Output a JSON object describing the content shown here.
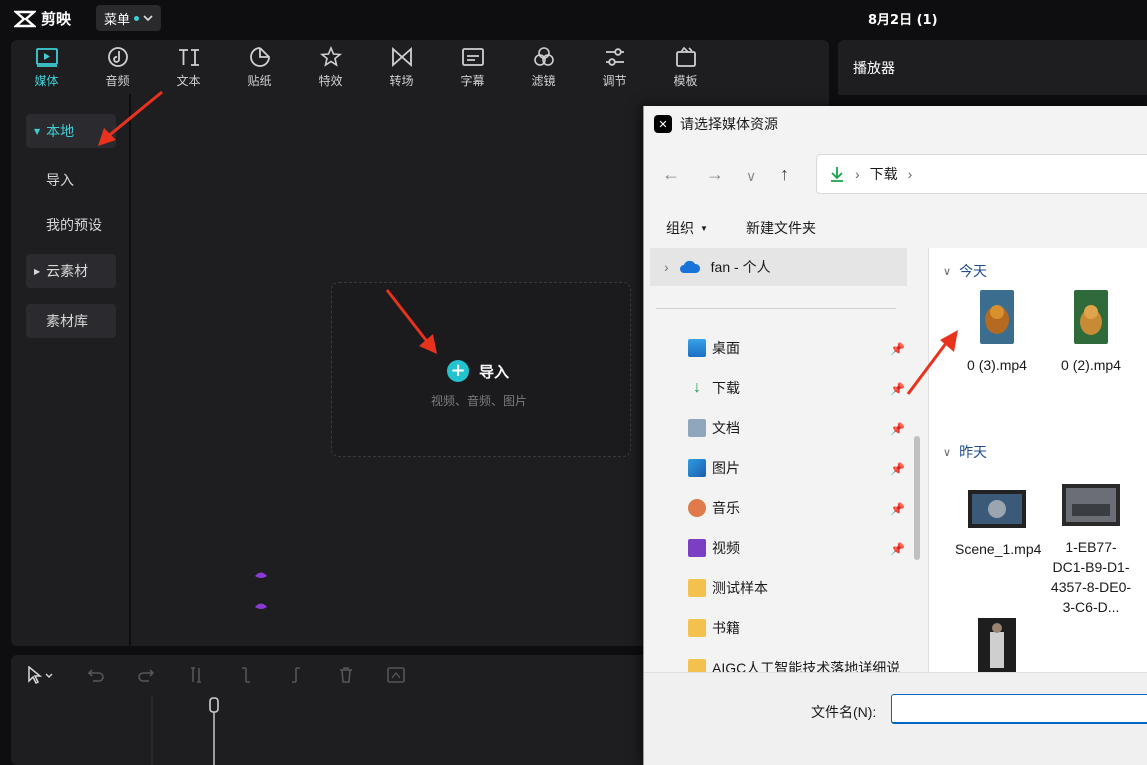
{
  "app": {
    "name": "剪映",
    "menu_label": "菜单",
    "project_title": "8月2日 (1)"
  },
  "tabs": [
    {
      "label": "媒体",
      "icon": "media-icon"
    },
    {
      "label": "音频",
      "icon": "audio-icon"
    },
    {
      "label": "文本",
      "icon": "text-icon"
    },
    {
      "label": "贴纸",
      "icon": "sticker-icon"
    },
    {
      "label": "特效",
      "icon": "effects-icon"
    },
    {
      "label": "转场",
      "icon": "transition-icon"
    },
    {
      "label": "字幕",
      "icon": "subtitle-icon"
    },
    {
      "label": "滤镜",
      "icon": "filter-icon"
    },
    {
      "label": "调节",
      "icon": "adjust-icon"
    },
    {
      "label": "模板",
      "icon": "template-icon"
    }
  ],
  "sidebar": {
    "local": "本地",
    "import": "导入",
    "presets": "我的预设",
    "cloud": "云素材",
    "library": "素材库"
  },
  "dropzone": {
    "import_label": "导入",
    "hint": "视频、音频、图片"
  },
  "player": {
    "title": "播放器"
  },
  "dialog": {
    "title": "请选择媒体资源",
    "breadcrumb": "下载",
    "organize": "组织",
    "new_folder": "新建文件夹",
    "onedrive": "fan - 个人",
    "nav_items": [
      {
        "label": "桌面",
        "pinned": true
      },
      {
        "label": "下载",
        "pinned": true
      },
      {
        "label": "文档",
        "pinned": true
      },
      {
        "label": "图片",
        "pinned": true
      },
      {
        "label": "音乐",
        "pinned": true
      },
      {
        "label": "视频",
        "pinned": true
      },
      {
        "label": "测试样本",
        "pinned": false
      },
      {
        "label": "书籍",
        "pinned": false
      },
      {
        "label": "AIGC人工智能技术落地详细说",
        "pinned": false
      }
    ],
    "group_today": "今天",
    "group_yesterday": "昨天",
    "files_today": [
      "0 (3).mp4",
      "0 (2).mp4"
    ],
    "files_yesterday": [
      "Scene_1.mp4",
      "1-EB77-DC1-B9-D1-4357-8-DE0-3-C6-D..."
    ],
    "filename_label": "文件名(N):",
    "filename_value": ""
  },
  "colors": {
    "accent": "#3ecfd6",
    "import_plus": "#22c2cf",
    "annotation_arrow": "#e8321e",
    "dialog_link": "#1f4e8f"
  }
}
